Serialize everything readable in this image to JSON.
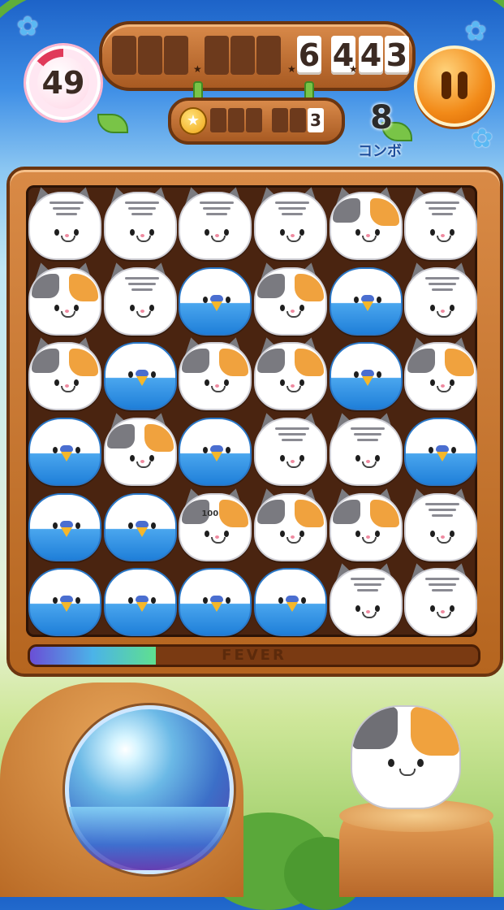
{
  "hud": {
    "score_digits": [
      "",
      "",
      "",
      "",
      "",
      "",
      "6",
      "4",
      "4",
      "3"
    ],
    "coin_digits": [
      "",
      "",
      "",
      "",
      "",
      "3"
    ],
    "timer_value": "49",
    "timer_remaining_fraction": 0.86,
    "combo_count": "8",
    "combo_label": "コンボ"
  },
  "fever": {
    "label": "FEVER",
    "progress": 0.28
  },
  "board": {
    "rows": [
      [
        "tiger",
        "tiger",
        "tiger",
        "tiger",
        "calico",
        "tiger"
      ],
      [
        "calico",
        "tiger",
        "bird",
        "calico",
        "bird",
        "tiger"
      ],
      [
        "calico",
        "bird",
        "calico",
        "calico",
        "bird",
        "calico"
      ],
      [
        "bird",
        "calico",
        "bird",
        "tiger",
        "tiger",
        "bird"
      ],
      [
        "bird",
        "bird",
        "calico",
        "calico",
        "calico",
        "tiger"
      ],
      [
        "bird",
        "bird",
        "bird",
        "bird",
        "tiger",
        "tiger"
      ]
    ],
    "popup_text": "100"
  },
  "icons": {
    "pause": "pause-icon",
    "coin": "star-coin-icon",
    "flower": "blue-flower-icon"
  },
  "colors": {
    "wood": "#b5651f",
    "accent_orange": "#f28a18",
    "bird_blue": "#1f7fd9",
    "fever_fill": "#5fe08f"
  }
}
